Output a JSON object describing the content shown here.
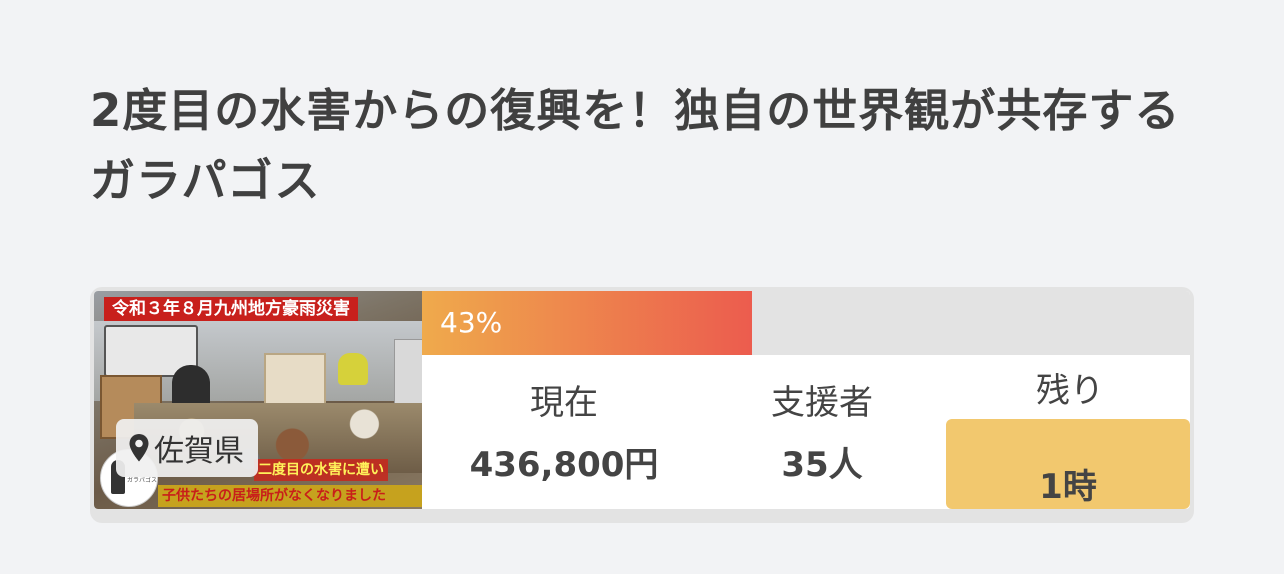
{
  "project": {
    "title": "2度目の水害からの復興を！独自の世界観が共存するガラパゴス",
    "thumbnail": {
      "banner": "令和３年８月九州地方豪雨災害",
      "caption_line1": "二度目の水害に遭い",
      "caption_line2": "子供たちの居場所がなくなりました",
      "logo_text": "ガラパゴス",
      "region": "佐賀県",
      "region_icon": "map-pin-icon"
    },
    "progress": {
      "percent_label": "43%",
      "fraction": 0.43,
      "colors": {
        "start": "#efaa4c",
        "end": "#ec5c4e",
        "track": "#e3e3e3"
      }
    },
    "stats": {
      "current_label": "現在",
      "current_value": "436,800円",
      "backers_label": "支援者",
      "backers_value": "35人",
      "remaining_label": "残り",
      "remaining_value": "1時",
      "remaining_color": "#f2c86e"
    }
  }
}
